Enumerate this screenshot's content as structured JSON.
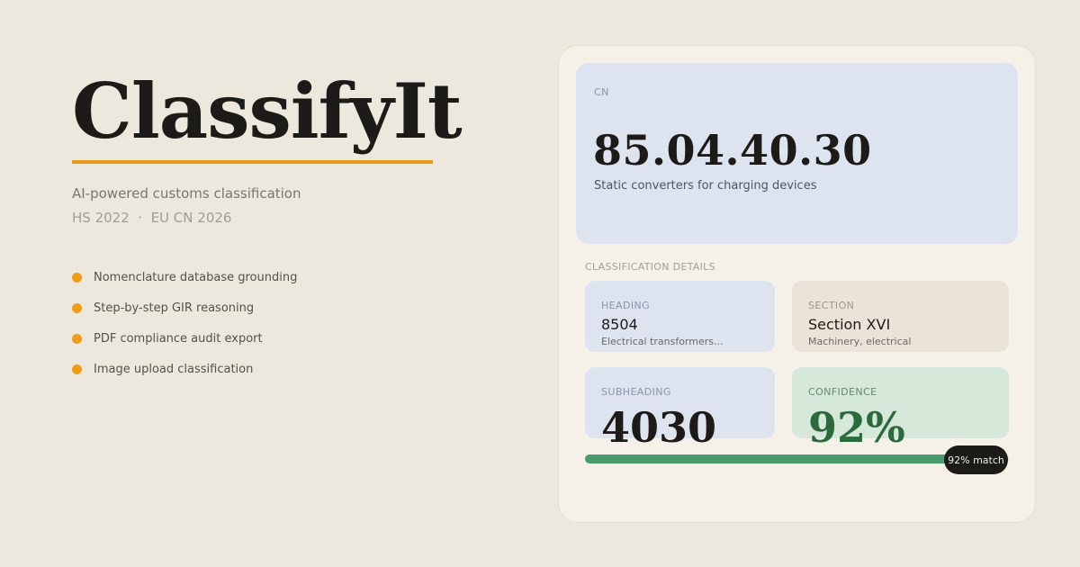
{
  "brand": {
    "name": "ClassifyIt",
    "tagline": "AI-powered customs classification",
    "standards": "HS 2022  ·  EU CN 2026"
  },
  "features": [
    {
      "label": "Nomenclature database grounding"
    },
    {
      "label": "Step-by-step GIR reasoning"
    },
    {
      "label": "PDF compliance audit export"
    },
    {
      "label": "Image upload classification"
    }
  ],
  "result": {
    "cn_label": "CN",
    "cn_code": "85.04.40.30",
    "cn_description": "Static converters for charging devices",
    "details_label": "CLASSIFICATION DETAILS",
    "heading": {
      "label": "HEADING",
      "value": "8504",
      "sub": "Electrical transformers..."
    },
    "section": {
      "label": "SECTION",
      "value": "Section XVI",
      "sub": "Machinery, electrical"
    },
    "subheading": {
      "label": "SUBHEADING",
      "value": "4030"
    },
    "confidence": {
      "label": "CONFIDENCE",
      "value": "92%",
      "fraction": 0.92,
      "badge": "92% match"
    }
  },
  "colors": {
    "accent": "#e89b1a",
    "feature_dot": "#f29b18",
    "confidence_text": "#2b6a3b",
    "progress": "#4a9a6c"
  }
}
